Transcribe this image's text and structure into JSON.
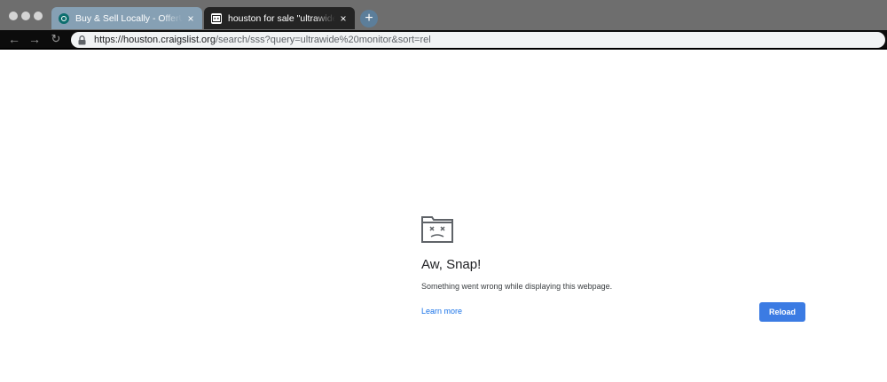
{
  "browser": {
    "tabs": [
      {
        "title": "Buy & Sell Locally - OfferUp - B",
        "favicon": "offerup-icon",
        "active": false,
        "close": "×"
      },
      {
        "title": "houston for sale \"ultrawide monitor\"",
        "favicon": "craigslist-icon",
        "active": true,
        "close": "×"
      }
    ],
    "new_tab": "+",
    "nav": {
      "back": "←",
      "forward": "→",
      "reload": "↻"
    },
    "omnibox": {
      "url_host": "https://houston.craigslist.org",
      "url_path": "/search/sss?query=ultrawide%20monitor&sort=rel",
      "lock_icon": "lock-icon"
    }
  },
  "error_page": {
    "icon": "sad-tab-icon",
    "heading": "Aw, Snap!",
    "message": "Something went wrong while displaying this webpage.",
    "learn_more": "Learn more",
    "reload": "Reload"
  },
  "colors": {
    "tabstrip": "#6e6e6e",
    "active_tab": "#242424",
    "toolbar": "#0c0c0c",
    "link": "#1a73e8",
    "button": "#3b7be3"
  }
}
